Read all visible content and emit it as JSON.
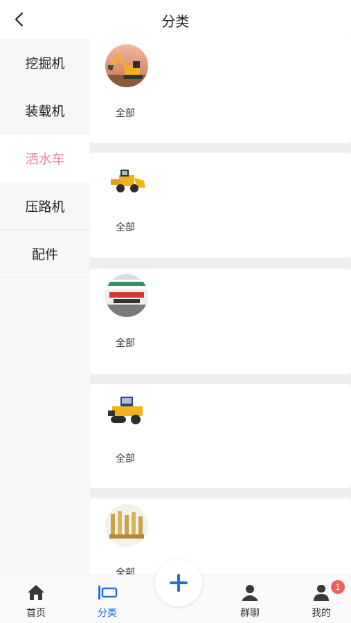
{
  "header": {
    "title": "分类",
    "back_icon": "chevron-left-icon"
  },
  "sidebar": {
    "items": [
      {
        "label": "挖掘机",
        "active": false
      },
      {
        "label": "装载机",
        "active": false
      },
      {
        "label": "洒水车",
        "active": true
      },
      {
        "label": "压路机",
        "active": false
      },
      {
        "label": "配件",
        "active": false
      }
    ],
    "active_color": "#e88aa5"
  },
  "content": {
    "cards": [
      {
        "label": "全部",
        "image": "excavator-image"
      },
      {
        "label": "全部",
        "image": "wheel-loader-image"
      },
      {
        "label": "全部",
        "image": "sprinkler-truck-image"
      },
      {
        "label": "全部",
        "image": "road-roller-image"
      },
      {
        "label": "全部",
        "image": "parts-fittings-image"
      }
    ]
  },
  "tabbar": {
    "tabs": [
      {
        "label": "首页",
        "icon": "home-icon"
      },
      {
        "label": "分类",
        "icon": "category-icon",
        "active": true
      },
      {
        "label": "群聊",
        "icon": "group-chat-icon"
      },
      {
        "label": "我的",
        "icon": "profile-icon",
        "badge": "1"
      }
    ],
    "plus_icon": "plus-icon",
    "accent": "#1f6fd8"
  }
}
